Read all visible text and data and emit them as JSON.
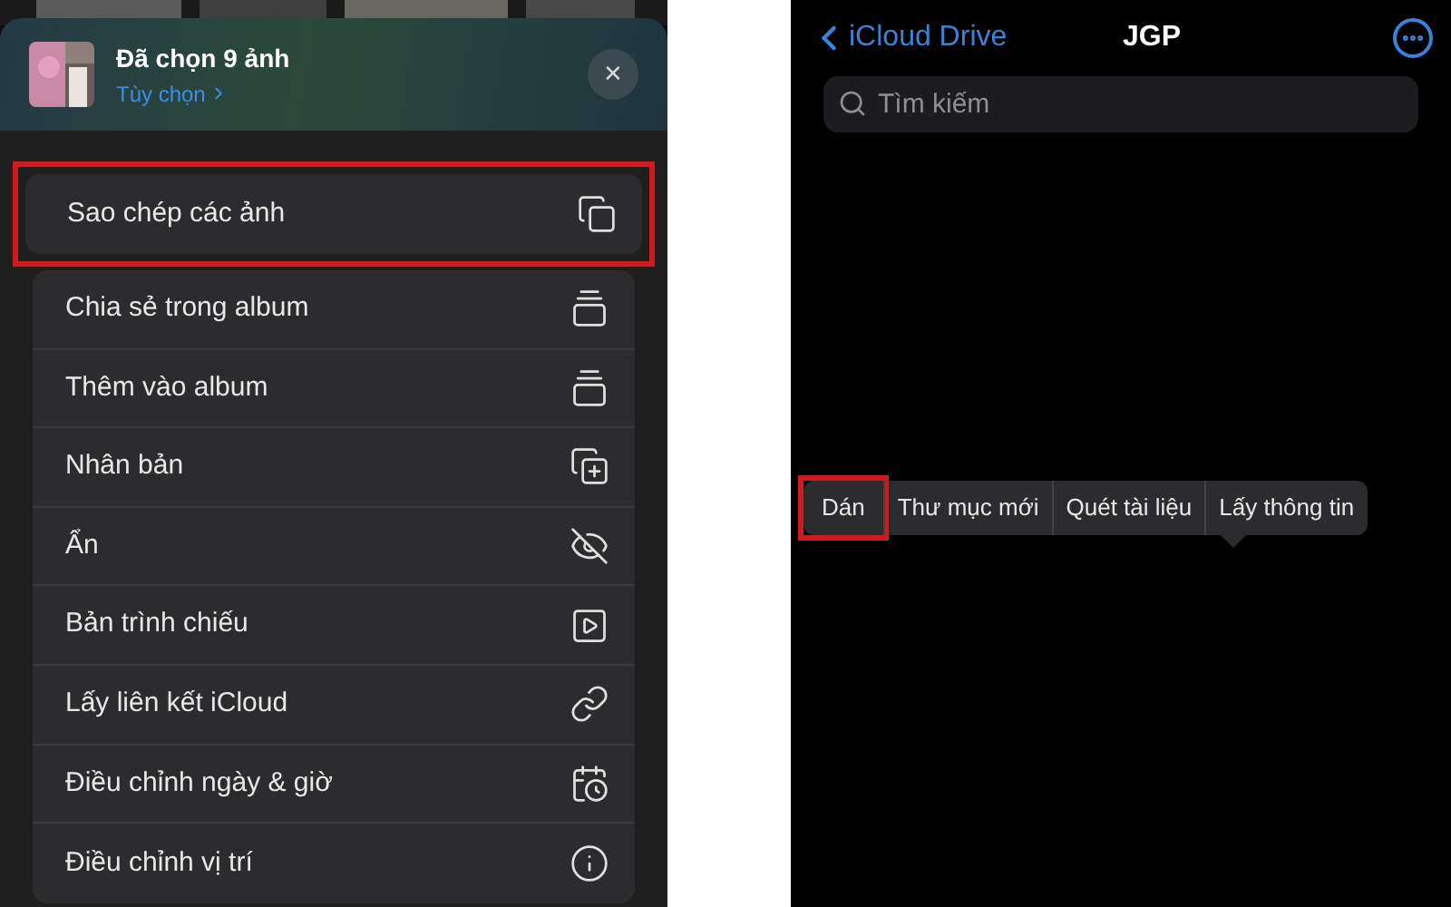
{
  "left": {
    "header": {
      "title": "Đã chọn 9 ảnh",
      "options_link": "Tùy chọn",
      "close": "✕"
    },
    "primary_action": {
      "label": "Sao chép các ảnh",
      "highlighted": true
    },
    "actions": [
      {
        "label": "Chia sẻ trong album"
      },
      {
        "label": "Thêm vào album"
      },
      {
        "label": "Nhân bản"
      },
      {
        "label": "Ẩn"
      },
      {
        "label": "Bản trình chiếu"
      },
      {
        "label": "Lấy liên kết iCloud"
      },
      {
        "label": "Điều chỉnh ngày & giờ"
      },
      {
        "label": "Điều chỉnh vị trí"
      }
    ]
  },
  "right": {
    "nav": {
      "back": "iCloud Drive",
      "title": "JGP"
    },
    "search": {
      "placeholder": "Tìm kiếm"
    },
    "context_menu": [
      {
        "label": "Dán",
        "highlighted": true
      },
      {
        "label": "Thư mục mới",
        "highlighted": false
      },
      {
        "label": "Quét tài liệu",
        "highlighted": false
      },
      {
        "label": "Lấy thông tin",
        "highlighted": false
      }
    ]
  }
}
